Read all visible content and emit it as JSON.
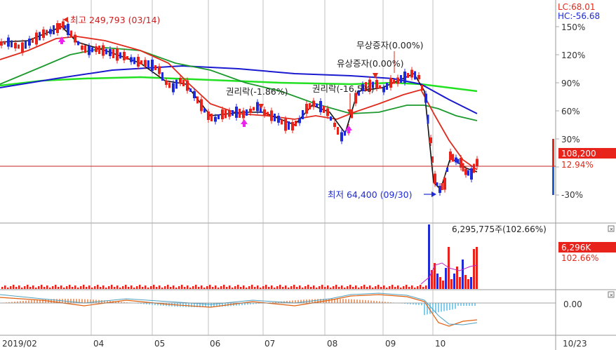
{
  "colors": {
    "up": "#e8231b",
    "down": "#1f2bd6",
    "ma5": "#111111",
    "ma20": "#e02a1c",
    "ma60": "#1c9a2e",
    "ma120": "#1a1ad0",
    "ma240": "#22e022",
    "grid": "#c8c8c8",
    "axis": "#b4b4b4"
  },
  "price_axis": {
    "labels": [
      "150%",
      "120%",
      "90%",
      "60%",
      "30%",
      "-30%"
    ],
    "lc": "LC:68.01",
    "hc": "HC:-56.68",
    "current_price": "108,200",
    "current_pct": "12.94%"
  },
  "annotations": {
    "high": "최고 249,793 (03/14)",
    "low": "최저 64,400 (09/30)",
    "bonus1": "무상증자(0.00%)",
    "bonus2": "유상증자(0.00%)",
    "ex_right1": "권리락(-1.86%)",
    "ex_right2": "권리락(-16.5%)"
  },
  "volume_panel": {
    "label": "6,295,775주(102.66%)",
    "tag_value": "6,296K",
    "tag_pct": "102.66%"
  },
  "macd_panel": {
    "tag": "0.00"
  },
  "x_axis": {
    "labels": [
      "2019/02",
      "04",
      "05",
      "06",
      "07",
      "08",
      "09",
      "10"
    ],
    "right_label": "10/23"
  }
}
